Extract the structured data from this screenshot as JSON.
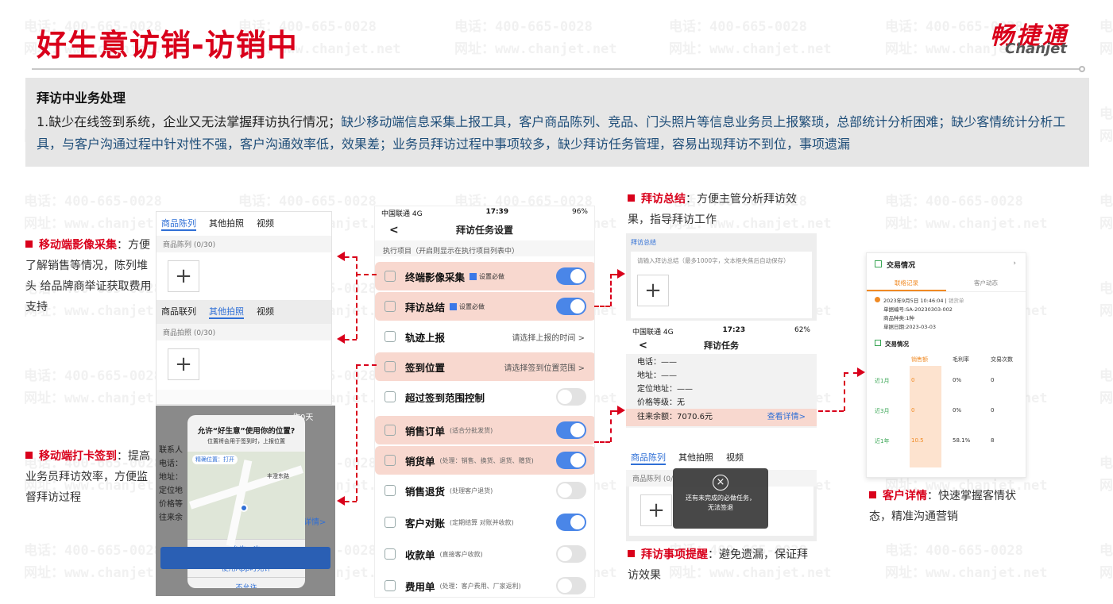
{
  "header": {
    "title": "好生意访销-访销中",
    "logo_cn": "畅捷通",
    "logo_en": "Chanjet"
  },
  "watermark": {
    "phone": "电话：400-665-0028",
    "site": "网址：www.chanjet.net"
  },
  "banner": {
    "heading": "拜访中业务处理",
    "text_black": "1.缺少在线签到系统，企业又无法掌握拜访执行情况；",
    "text_blue": "缺少移动端信息采集上报工具，客户商品陈列、竞品、门头照片等信息业务员上报繁琐，总部统计分析困难；缺少客情统计分析工具，与客户沟通过程中针对性不强，客户沟通效率低，效果差；业务员拜访过程中事项较多，缺少拜访任务管理，容易出现拜访不到位，事项遗漏"
  },
  "notes": {
    "image": {
      "title": "移动端影像采集",
      "sep": "：",
      "body": "方便了解销售等情况，陈列堆 头 给品牌商举证获取费用支持"
    },
    "checkin": {
      "title": "移动端打卡签到",
      "sep": "：",
      "body": "提高业务员拜访效率，方便监督拜访过程"
    },
    "summary": {
      "title": "拜访总结",
      "sep": "：",
      "body": "方便主管分析拜访效果，指导拜访工作"
    },
    "reminder": {
      "title": "拜访事项提醒",
      "sep": "：",
      "body": "避免遗漏，保证拜访效果"
    },
    "customer": {
      "title": "客户详情",
      "sep": "：",
      "body": "快速掌握客情状态，精准沟通营销"
    }
  },
  "photo_panel": {
    "tabs_top": [
      "商品陈列",
      "其他拍照",
      "视频"
    ],
    "sub_top": "商品陈列 (0/30)",
    "tabs_bottom": [
      "商品联列",
      "其他拍照",
      "视频"
    ],
    "sub_bottom": "商品拍照 (0/30)",
    "plus": "+"
  },
  "location_panel": {
    "dialog_title": "允许“好生意”使用你的位置?",
    "dialog_sub": "位置将会用于签到时，上报位置",
    "precise": "精确位置：打开",
    "road": "丰澄东路",
    "side_labels": [
      "联系人",
      "电话：",
      "地址：",
      "定位地",
      "价格等",
      "往来余"
    ],
    "corner": "作0天",
    "detail_link": "详情>",
    "btn_once": "允许一次",
    "btn_while": "使用App时允许",
    "btn_deny": "不允许"
  },
  "settings_phone": {
    "status_left": "中国联通 4G",
    "time": "17:39",
    "battery": "96%",
    "back": "<",
    "title": "拜访任务设置",
    "hint": "执行项目（开启则显示在执行项目列表中）",
    "rows": [
      {
        "label": "终端影像采集",
        "extra": "设置必做",
        "toggle": "on",
        "hl": true
      },
      {
        "label": "拜访总结",
        "extra": "设置必做",
        "toggle": "on",
        "hl": true
      },
      {
        "label": "轨迹上报",
        "right": "请选择上报的时间 >",
        "hl": false
      },
      {
        "label": "签到位置",
        "right": "请选择签到位置范围 >",
        "hl": true
      },
      {
        "label": "超过签到范围控制",
        "toggle": "off",
        "hl": false
      },
      {
        "label": "销售订单",
        "small": "(适合分批发货)",
        "toggle": "on",
        "hl": true
      },
      {
        "label": "销货单",
        "small": "(处理：销售、换货、退货、赠货)",
        "toggle": "on",
        "hl": true
      },
      {
        "label": "销售退货",
        "small": "(处理客户退货)",
        "toggle": "off",
        "hl": false
      },
      {
        "label": "客户对账",
        "small": "(定期结算 对账并收款)",
        "toggle": "on",
        "hl": false
      },
      {
        "label": "收款单",
        "small": "(直接客户收款)",
        "toggle": "off",
        "hl": false
      },
      {
        "label": "费用单",
        "small": "(处理：客户费用、厂家返利)",
        "toggle": "off",
        "hl": false
      }
    ]
  },
  "summary_panel": {
    "title": "拜访总结",
    "placeholder": "请输入拜访总结（最多1000字，文本框失焦后自动保存）",
    "plus": "+"
  },
  "task_phone": {
    "status_left": "中国联通 4G",
    "time": "17:23",
    "battery": "62%",
    "back": "<",
    "title": "拜访任务",
    "lines": [
      "电话：——",
      "地址：——",
      "定位地址：——",
      "价格等级：无"
    ],
    "balance_label": "往来余额：7070.6元",
    "balance_link": "查看详情>"
  },
  "reminder_panel": {
    "tabs": [
      "商品陈列",
      "其他拍照",
      "视频"
    ],
    "sub": "商品陈列 (0/",
    "plus": "+",
    "toast_icon": "×",
    "toast_line1": "还有未完成的必做任务，",
    "toast_line2": "无法签退"
  },
  "customer_panel": {
    "title": "交易情况",
    "tab_on": "联络记录",
    "tab_off": "客户动态",
    "record_time": "2023年9月5日 10:46:04",
    "record_tag": "销货单",
    "record_lines": [
      "单据编号:SA-20230303-002",
      "商品种类:1种",
      "单据日期:2023-03-03"
    ],
    "sub_title": "交易情况",
    "table_head": [
      "",
      "销售额",
      "毛利率",
      "交易次数"
    ],
    "table_rows": [
      [
        "近1月",
        "0",
        "0%",
        "0"
      ],
      [
        "近3月",
        "0",
        "0%",
        "0"
      ],
      [
        "近1年",
        "10.5",
        "58.1%",
        "8"
      ]
    ]
  },
  "colors": {
    "brand_red": "#d9001b",
    "banner_gray": "#e6e6e6",
    "highlight_pink": "#f8d8cf",
    "toggle_blue": "#4a86e8",
    "blue_text": "#1f4e79"
  }
}
